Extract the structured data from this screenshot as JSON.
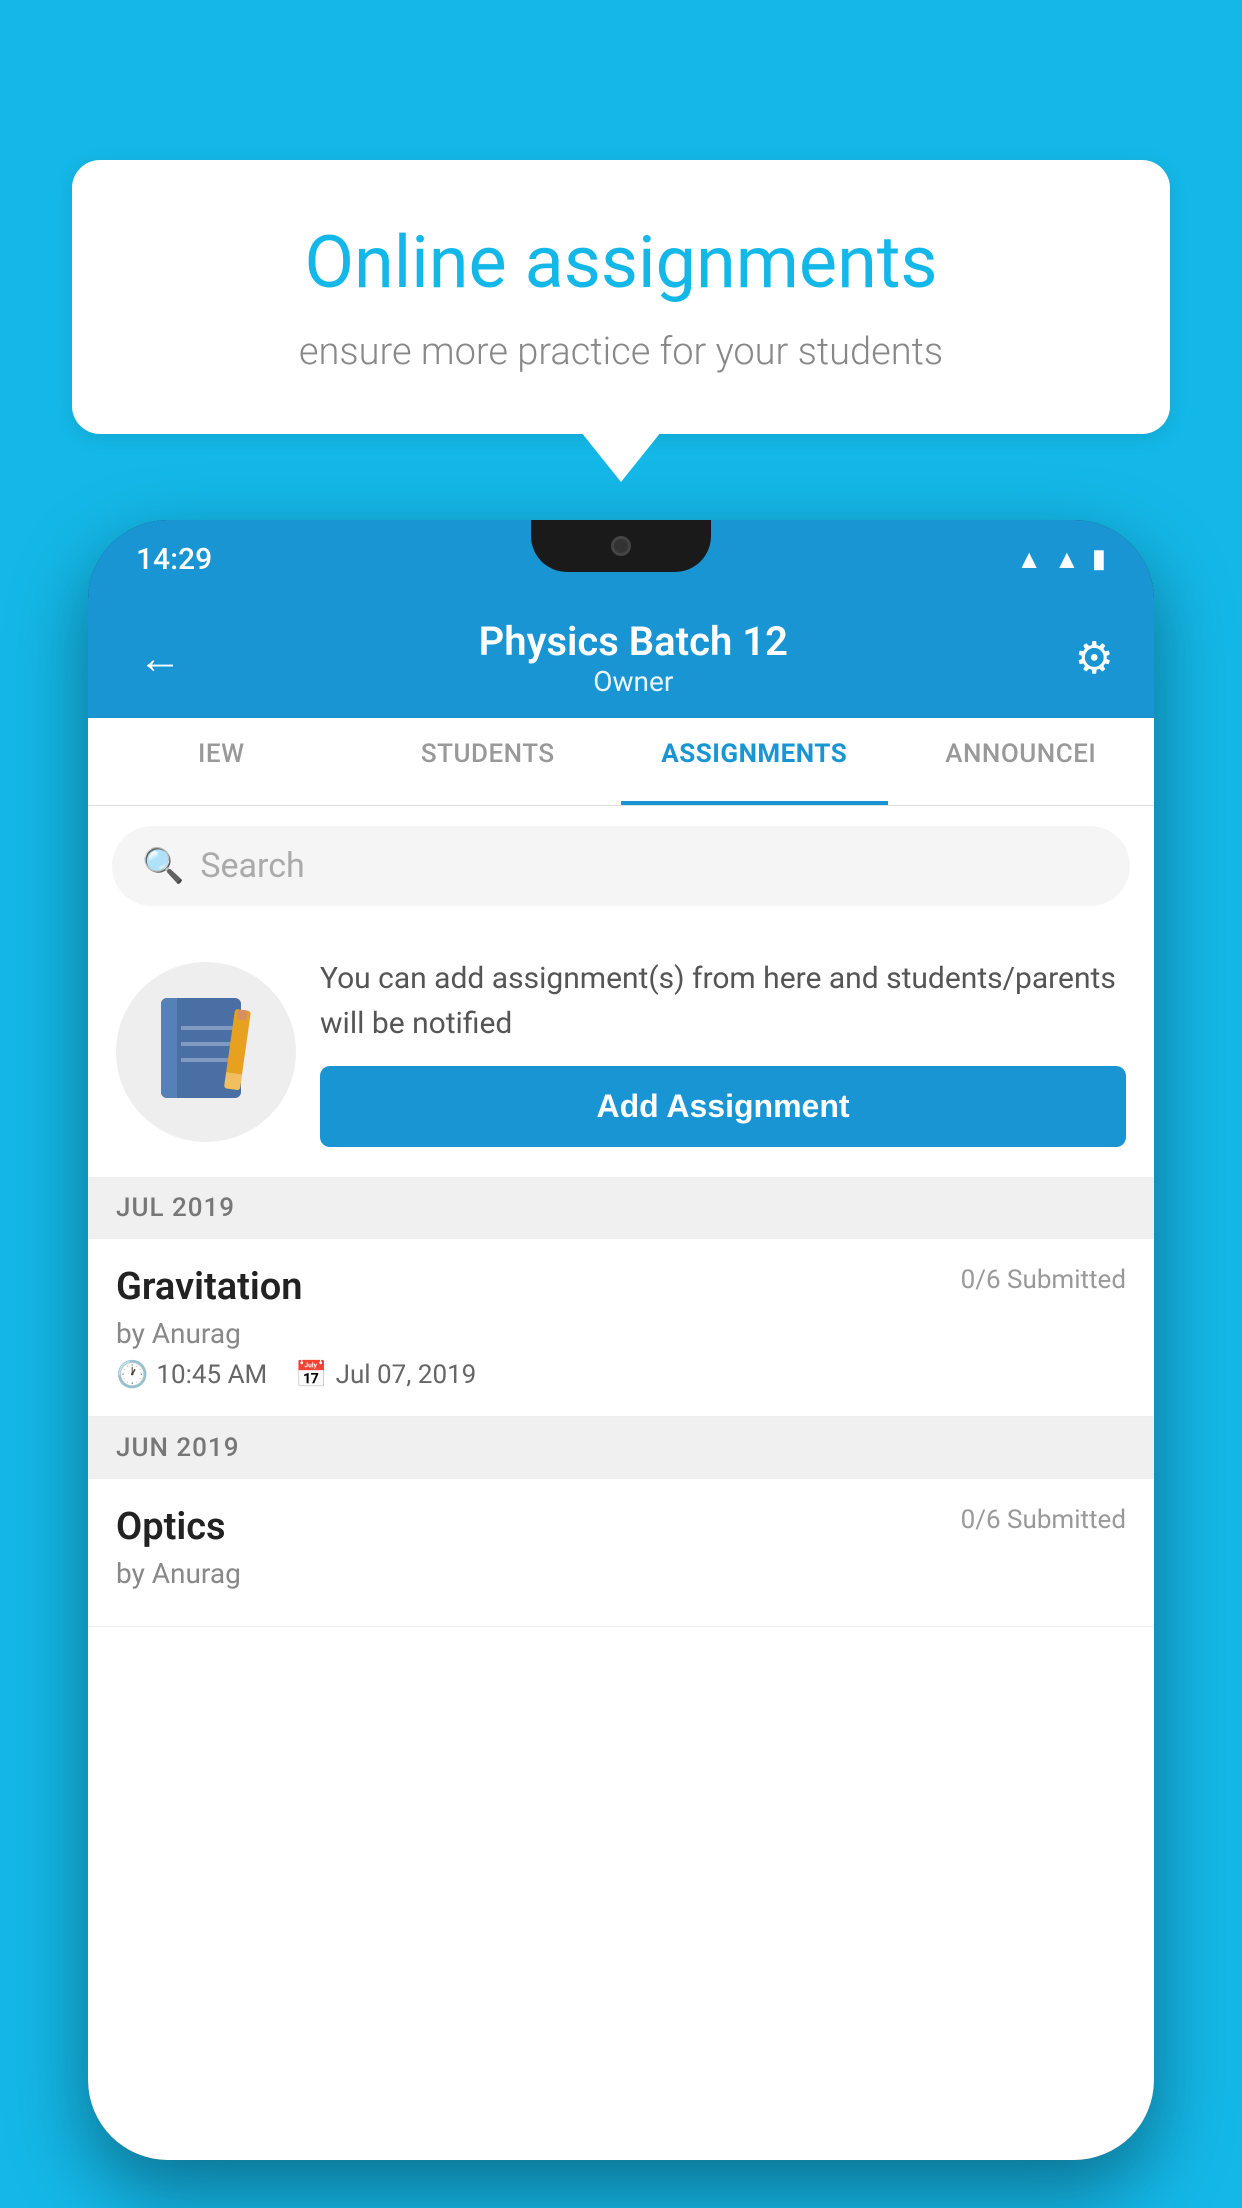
{
  "background": {
    "color": "#14B8E8"
  },
  "speech_bubble": {
    "title": "Online assignments",
    "subtitle": "ensure more practice for your students"
  },
  "phone": {
    "status_bar": {
      "time": "14:29",
      "wifi_icon": "wifi",
      "signal_icon": "signal",
      "battery_icon": "battery"
    },
    "header": {
      "title": "Physics Batch 12",
      "subtitle": "Owner",
      "back_label": "←",
      "settings_label": "⚙"
    },
    "tabs": [
      {
        "label": "IEW",
        "active": false
      },
      {
        "label": "STUDENTS",
        "active": false
      },
      {
        "label": "ASSIGNMENTS",
        "active": true
      },
      {
        "label": "ANNOUNCEI",
        "active": false
      }
    ],
    "search": {
      "placeholder": "Search"
    },
    "info_box": {
      "text": "You can add assignment(s) from here and students/parents will be notified",
      "button_label": "Add Assignment"
    },
    "sections": [
      {
        "label": "JUL 2019",
        "assignments": [
          {
            "name": "Gravitation",
            "submitted": "0/6 Submitted",
            "by": "by Anurag",
            "time": "10:45 AM",
            "date": "Jul 07, 2019"
          }
        ]
      },
      {
        "label": "JUN 2019",
        "assignments": [
          {
            "name": "Optics",
            "submitted": "0/6 Submitted",
            "by": "by Anurag",
            "time": "",
            "date": ""
          }
        ]
      }
    ]
  }
}
